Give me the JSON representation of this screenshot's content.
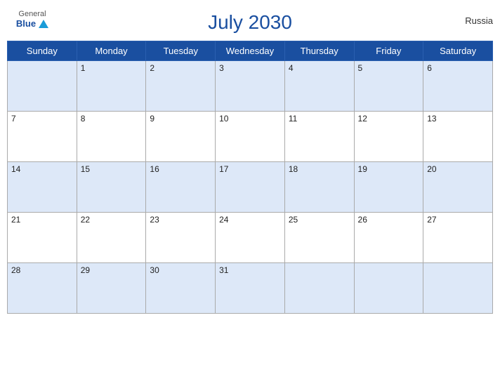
{
  "header": {
    "title": "July 2030",
    "country": "Russia",
    "logo_general": "General",
    "logo_blue": "Blue"
  },
  "days_of_week": [
    "Sunday",
    "Monday",
    "Tuesday",
    "Wednesday",
    "Thursday",
    "Friday",
    "Saturday"
  ],
  "weeks": [
    [
      null,
      1,
      2,
      3,
      4,
      5,
      6
    ],
    [
      7,
      8,
      9,
      10,
      11,
      12,
      13
    ],
    [
      14,
      15,
      16,
      17,
      18,
      19,
      20
    ],
    [
      21,
      22,
      23,
      24,
      25,
      26,
      27
    ],
    [
      28,
      29,
      30,
      31,
      null,
      null,
      null
    ]
  ]
}
